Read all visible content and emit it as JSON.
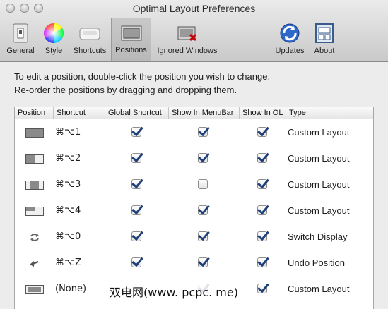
{
  "window": {
    "title": "Optimal Layout Preferences"
  },
  "toolbar": {
    "items": [
      {
        "label": "General"
      },
      {
        "label": "Style"
      },
      {
        "label": "Shortcuts"
      },
      {
        "label": "Positions"
      },
      {
        "label": "Ignored Windows"
      },
      {
        "label": "Updates"
      },
      {
        "label": "About"
      }
    ],
    "selected": "Positions"
  },
  "instructions": {
    "line1": "To edit a position, double-click the position you wish to change.",
    "line2": "Re-order the positions by dragging and dropping them."
  },
  "table": {
    "headers": [
      "Position",
      "Shortcut",
      "Global Shortcut",
      "Show In MenuBar",
      "Show In OL",
      "Type"
    ],
    "rows": [
      {
        "icon": "full-layout-icon",
        "shortcut": "⌘⌥1",
        "global": true,
        "menubar": true,
        "ol": true,
        "type": "Custom Layout"
      },
      {
        "icon": "left-half-layout-icon",
        "shortcut": "⌘⌥2",
        "global": true,
        "menubar": true,
        "ol": true,
        "type": "Custom Layout"
      },
      {
        "icon": "center-layout-icon",
        "shortcut": "⌘⌥3",
        "global": true,
        "menubar": false,
        "ol": true,
        "type": "Custom Layout"
      },
      {
        "icon": "corner-layout-icon",
        "shortcut": "⌘⌥4",
        "global": true,
        "menubar": true,
        "ol": true,
        "type": "Custom Layout"
      },
      {
        "icon": "switch-display-icon",
        "shortcut": "⌘⌥0",
        "global": true,
        "menubar": true,
        "ol": true,
        "type": "Switch Display"
      },
      {
        "icon": "undo-arrow-icon",
        "shortcut": "⌘⌥Z",
        "global": true,
        "menubar": true,
        "ol": true,
        "type": "Undo Position"
      },
      {
        "icon": "centered-window-icon",
        "shortcut": "(None)",
        "global": false,
        "menubar": true,
        "ol": true,
        "type": "Custom Layout"
      }
    ]
  },
  "watermark": "双电网(www. pcpc. me)"
}
